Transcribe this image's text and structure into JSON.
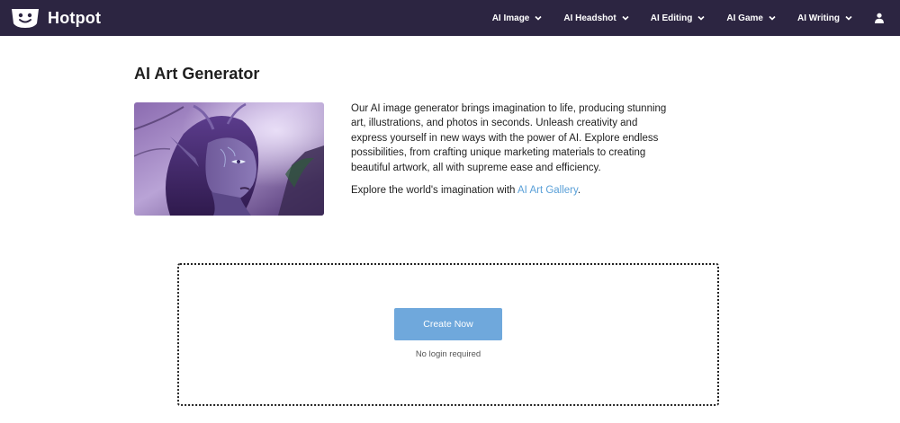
{
  "brand": {
    "name": "Hotpot"
  },
  "nav": {
    "items": [
      {
        "label": "AI Image"
      },
      {
        "label": "AI Headshot"
      },
      {
        "label": "AI Editing"
      },
      {
        "label": "AI Game"
      },
      {
        "label": "AI Writing"
      }
    ]
  },
  "page": {
    "title": "AI Art Generator",
    "intro_text": "Our AI image generator brings imagination to life, producing stunning art, illustrations, and photos in seconds. Unleash creativity and express yourself in new ways with the power of AI. Explore endless possibilities, from crafting unique marketing materials to creating beautiful artwork, all with supreme ease and efficiency.",
    "explore_prefix": "Explore the world's imagination with ",
    "gallery_link": "AI Art Gallery",
    "explore_suffix": "."
  },
  "create": {
    "button_label": "Create Now",
    "note": "No login required"
  },
  "colors": {
    "navbar": "#2c2541",
    "button": "#6fa8dc",
    "link": "#5aa0d8"
  }
}
